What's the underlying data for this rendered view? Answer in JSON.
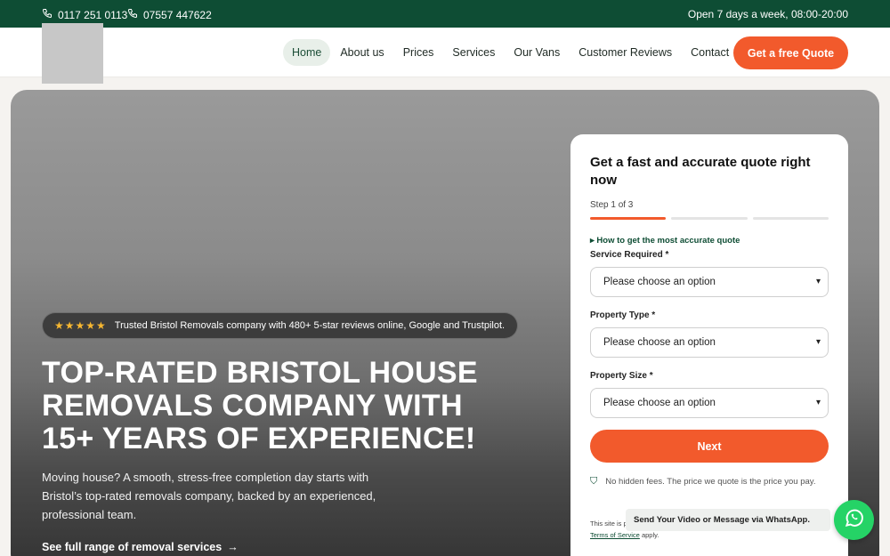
{
  "topbar": {
    "phone1": "0117 251 0113",
    "phone2": "07557 447622",
    "hours": "Open 7 days a week, 08:00-20:00"
  },
  "header": {
    "nav": [
      "Home",
      "About us",
      "Prices",
      "Services",
      "Our Vans",
      "Customer Reviews",
      "Contact"
    ],
    "active_nav": "Home",
    "cta": "Get a free Quote"
  },
  "hero": {
    "stars": "★★★★★",
    "badge_text": "Trusted Bristol Removals company with 480+ 5-star reviews online, Google and Trustpilot.",
    "headline_lines": [
      "TOP-RATED BRISTOL HOUSE",
      "REMOVALS COMPANY WITH",
      "15+ YEARS OF EXPERIENCE!"
    ],
    "sub_lines": [
      "Moving house? A smooth, stress-free completion day starts with",
      "Bristol’s top-rated removals company, backed by an experienced,",
      "professional team."
    ],
    "link": "See full range of removal services"
  },
  "quote_form": {
    "title": "Get a fast and accurate quote right now",
    "step": "Step 1 of 3",
    "progress": {
      "current": 1,
      "total": 3
    },
    "how_link": "How to get the most accurate quote",
    "fields": [
      {
        "label": "Service Required *",
        "value": "Please choose an option"
      },
      {
        "label": "Property Type *",
        "value": "Please choose an option"
      },
      {
        "label": "Property Size *",
        "value": "Please choose an option"
      }
    ],
    "next": "Next",
    "fees_note": "No hidden fees. The price we quote is the price you pay.",
    "legal_prefix": "This site is p",
    "legal_tos": "Terms of Service",
    "legal_suffix": " apply."
  },
  "whatsapp": {
    "tooltip": "Send Your Video or Message via WhatsApp."
  },
  "colors": {
    "brand_green": "#0e4d34",
    "accent_orange": "#f25a2c",
    "star": "#f7b731",
    "whatsapp": "#25d366"
  }
}
